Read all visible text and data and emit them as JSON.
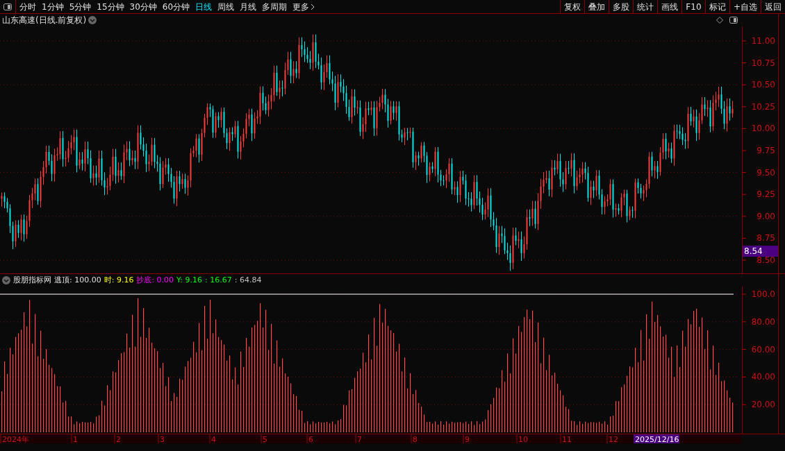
{
  "toolbar": {
    "periods": [
      {
        "label": "分时",
        "selected": false
      },
      {
        "label": "1分钟",
        "selected": false
      },
      {
        "label": "5分钟",
        "selected": false
      },
      {
        "label": "15分钟",
        "selected": false
      },
      {
        "label": "30分钟",
        "selected": false
      },
      {
        "label": "60分钟",
        "selected": false
      },
      {
        "label": "日线",
        "selected": true
      },
      {
        "label": "周线",
        "selected": false
      },
      {
        "label": "月线",
        "selected": false
      },
      {
        "label": "多周期",
        "selected": false
      },
      {
        "label": "更多",
        "selected": false
      }
    ],
    "actions": [
      "复权",
      "叠加",
      "多股",
      "统计",
      "画线",
      "F10",
      "标记",
      "+自选",
      "返回"
    ]
  },
  "main_chart": {
    "title": "山东高速(日线.前复权)",
    "y_ticks": [
      "11.00",
      "10.75",
      "10.50",
      "10.25",
      "10.00",
      "9.75",
      "9.50",
      "9.25",
      "9.00",
      "8.75",
      "8.50"
    ],
    "last_price": "8.54"
  },
  "indicator": {
    "name": "股朋指标网",
    "readouts": [
      {
        "text": "逃顶: 100.00",
        "color": "#e0e0e0"
      },
      {
        "text": "时: 9.16",
        "color": "#ffff00"
      },
      {
        "text": "抄底: 0.00",
        "color": "#ff00ff"
      },
      {
        "text": "Y: 9.16",
        "color": "#00ff00"
      },
      {
        "text": ": 16.67",
        "color": "#00ff00"
      },
      {
        "text": ": 64.84",
        "color": "#c0c0c0"
      }
    ],
    "y_ticks": [
      "100.0",
      "80.00",
      "60.00",
      "40.00",
      "20.00"
    ]
  },
  "date_axis": {
    "labels": [
      "2024年",
      "1",
      "2",
      "3",
      "4",
      "5",
      "6",
      "7",
      "8",
      "9",
      "10",
      "11",
      "12"
    ],
    "current": "2025/12/16"
  }
}
